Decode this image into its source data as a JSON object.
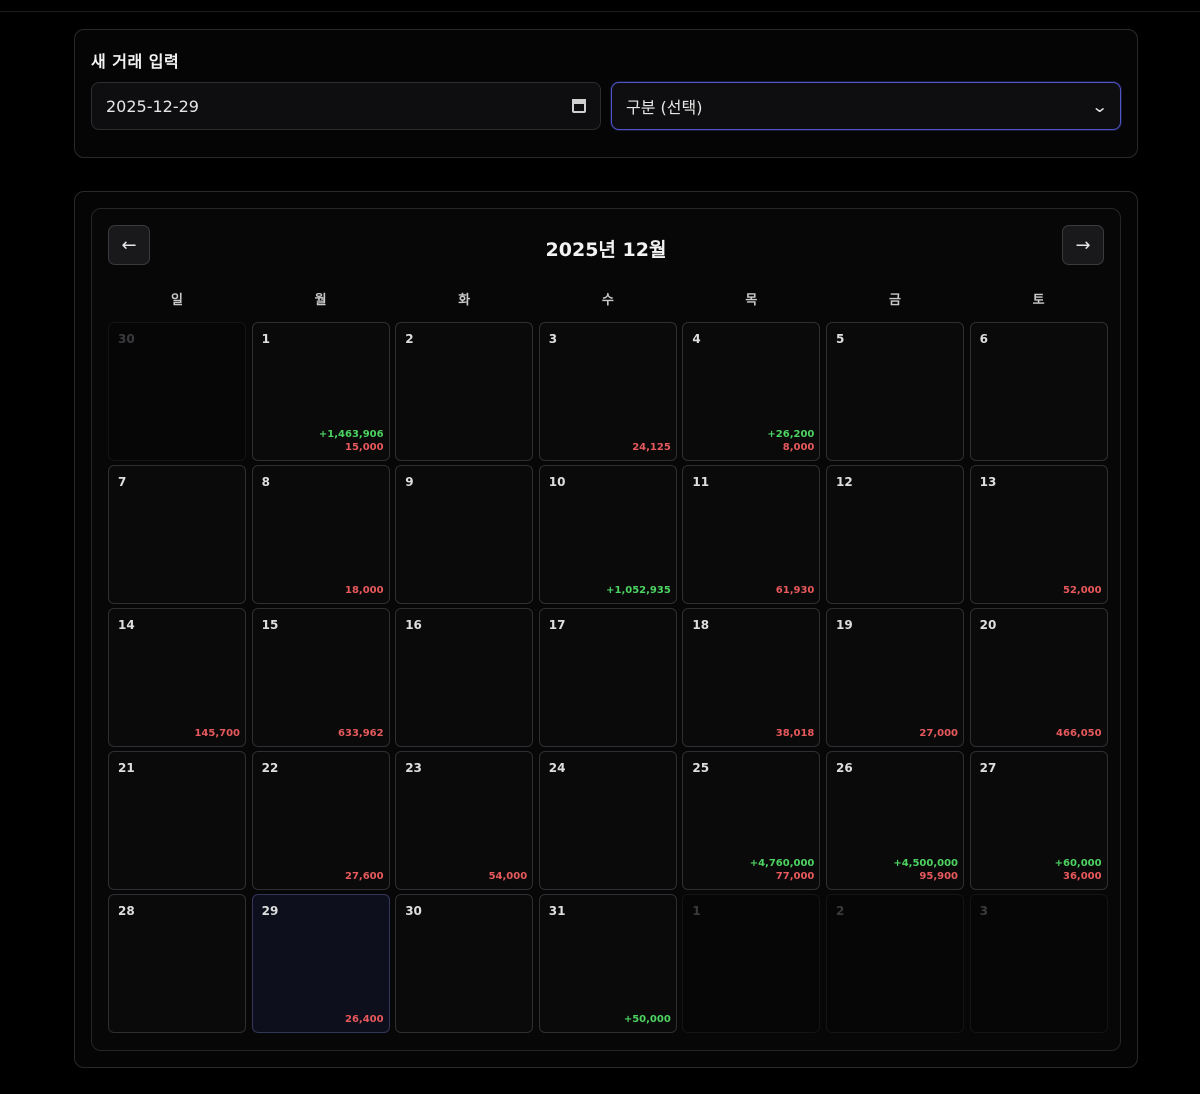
{
  "entry": {
    "title": "새 거래 입력",
    "date_value": "2025-12-29",
    "category_selected": "구분 (선택)"
  },
  "calendar": {
    "prev_label": "←",
    "next_label": "→",
    "month_title": "2025년 12월",
    "weekdays": [
      "일",
      "월",
      "화",
      "수",
      "목",
      "금",
      "토"
    ],
    "weeks": [
      [
        {
          "day": "30",
          "other": true,
          "income": "",
          "expense": ""
        },
        {
          "day": "1",
          "other": false,
          "income": "+1,463,906",
          "expense": "15,000"
        },
        {
          "day": "2",
          "other": false,
          "income": "",
          "expense": ""
        },
        {
          "day": "3",
          "other": false,
          "income": "",
          "expense": "24,125"
        },
        {
          "day": "4",
          "other": false,
          "income": "+26,200",
          "expense": "8,000"
        },
        {
          "day": "5",
          "other": false,
          "income": "",
          "expense": ""
        },
        {
          "day": "6",
          "other": false,
          "income": "",
          "expense": ""
        }
      ],
      [
        {
          "day": "7",
          "other": false,
          "income": "",
          "expense": ""
        },
        {
          "day": "8",
          "other": false,
          "income": "",
          "expense": "18,000"
        },
        {
          "day": "9",
          "other": false,
          "income": "",
          "expense": ""
        },
        {
          "day": "10",
          "other": false,
          "income": "+1,052,935",
          "expense": ""
        },
        {
          "day": "11",
          "other": false,
          "income": "",
          "expense": "61,930"
        },
        {
          "day": "12",
          "other": false,
          "income": "",
          "expense": ""
        },
        {
          "day": "13",
          "other": false,
          "income": "",
          "expense": "52,000"
        }
      ],
      [
        {
          "day": "14",
          "other": false,
          "income": "",
          "expense": "145,700"
        },
        {
          "day": "15",
          "other": false,
          "income": "",
          "expense": "633,962"
        },
        {
          "day": "16",
          "other": false,
          "income": "",
          "expense": ""
        },
        {
          "day": "17",
          "other": false,
          "income": "",
          "expense": ""
        },
        {
          "day": "18",
          "other": false,
          "income": "",
          "expense": "38,018"
        },
        {
          "day": "19",
          "other": false,
          "income": "",
          "expense": "27,000"
        },
        {
          "day": "20",
          "other": false,
          "income": "",
          "expense": "466,050"
        }
      ],
      [
        {
          "day": "21",
          "other": false,
          "income": "",
          "expense": ""
        },
        {
          "day": "22",
          "other": false,
          "income": "",
          "expense": "27,600"
        },
        {
          "day": "23",
          "other": false,
          "income": "",
          "expense": "54,000"
        },
        {
          "day": "24",
          "other": false,
          "income": "",
          "expense": ""
        },
        {
          "day": "25",
          "other": false,
          "income": "+4,760,000",
          "expense": "77,000"
        },
        {
          "day": "26",
          "other": false,
          "income": "+4,500,000",
          "expense": "95,900"
        },
        {
          "day": "27",
          "other": false,
          "income": "+60,000",
          "expense": "36,000"
        }
      ],
      [
        {
          "day": "28",
          "other": false,
          "income": "",
          "expense": ""
        },
        {
          "day": "29",
          "other": false,
          "today": true,
          "income": "",
          "expense": "26,400"
        },
        {
          "day": "30",
          "other": false,
          "income": "",
          "expense": ""
        },
        {
          "day": "31",
          "other": false,
          "income": "+50,000",
          "expense": ""
        },
        {
          "day": "1",
          "other": true,
          "income": "",
          "expense": ""
        },
        {
          "day": "2",
          "other": true,
          "income": "",
          "expense": ""
        },
        {
          "day": "3",
          "other": true,
          "income": "",
          "expense": ""
        }
      ]
    ]
  },
  "colors": {
    "income": "#4cd361",
    "expense": "#e7595c",
    "accent": "#5055c9",
    "background": "#000000"
  }
}
